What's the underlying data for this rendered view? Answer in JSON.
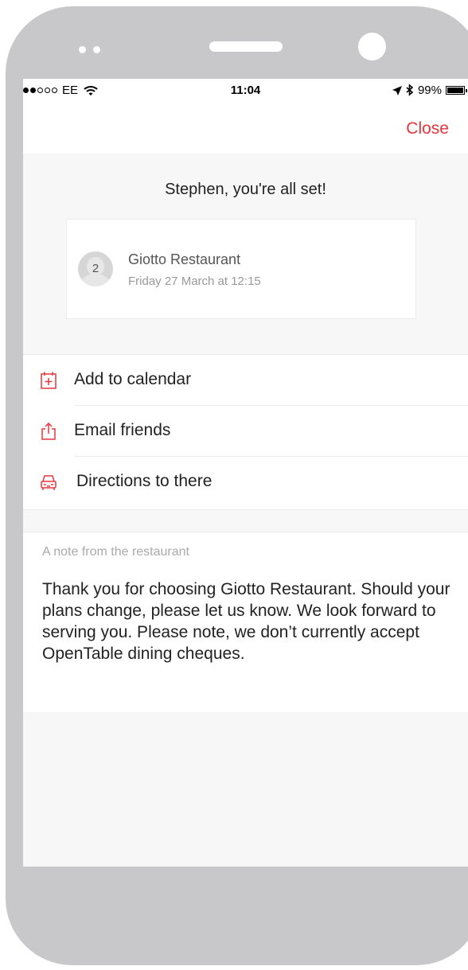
{
  "status_bar": {
    "carrier": "EE",
    "time": "11:04",
    "battery": "99%"
  },
  "nav": {
    "close_label": "Close"
  },
  "confirmation": {
    "headline": "Stephen, you're all set!",
    "party_size": "2",
    "restaurant_name": "Giotto Restaurant",
    "reservation_time": "Friday 27 March at 12:15"
  },
  "actions": [
    {
      "label": "Add to calendar",
      "icon": "calendar-add-icon"
    },
    {
      "label": "Email friends",
      "icon": "share-icon"
    },
    {
      "label": "Directions to there",
      "icon": "car-icon"
    }
  ],
  "note": {
    "title": "A note from the restaurant",
    "body": "Thank you for choosing Giotto Restaurant. Should your plans change, please let us know. We look forward to serving you. Please note, we don’t currently accept OpenTable dining cheques."
  },
  "colors": {
    "accent": "#e5363d",
    "device_frame": "#c8c8ca",
    "screen_background": "#f7f7f7"
  }
}
